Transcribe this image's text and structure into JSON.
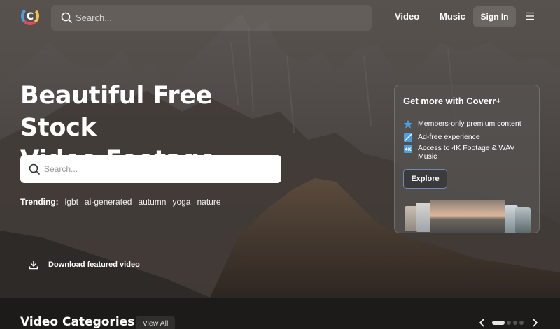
{
  "header": {
    "search_placeholder": "Search...",
    "nav": {
      "video": "Video",
      "music": "Music"
    },
    "signin_label": "Sign In"
  },
  "hero": {
    "headline_line1": "Beautiful Free Stock",
    "headline_line2": "Video Footage",
    "search_placeholder": "Search...",
    "trending_label": "Trending:",
    "trending_tags": [
      "lgbt",
      "ai-generated",
      "autumn",
      "yoga",
      "nature"
    ],
    "download_label": "Download featured video"
  },
  "promo": {
    "title": "Get more with Coverr+",
    "features": [
      {
        "icon": "star-badge-icon",
        "text": "Members-only premium content"
      },
      {
        "icon": "ad-free-icon",
        "text": "Ad-free experience"
      },
      {
        "icon": "4k-icon",
        "text": "Access to 4K Footage & WAV Music"
      }
    ],
    "explore_label": "Explore"
  },
  "categories": {
    "title": "Video Categories",
    "view_all_label": "View All",
    "carousel_pages": 4,
    "active_page": 1
  },
  "colors": {
    "accent_blue": "#4d9fe0",
    "card_border": "#6f8bb5",
    "bottom_bg": "#1c1b1a"
  }
}
